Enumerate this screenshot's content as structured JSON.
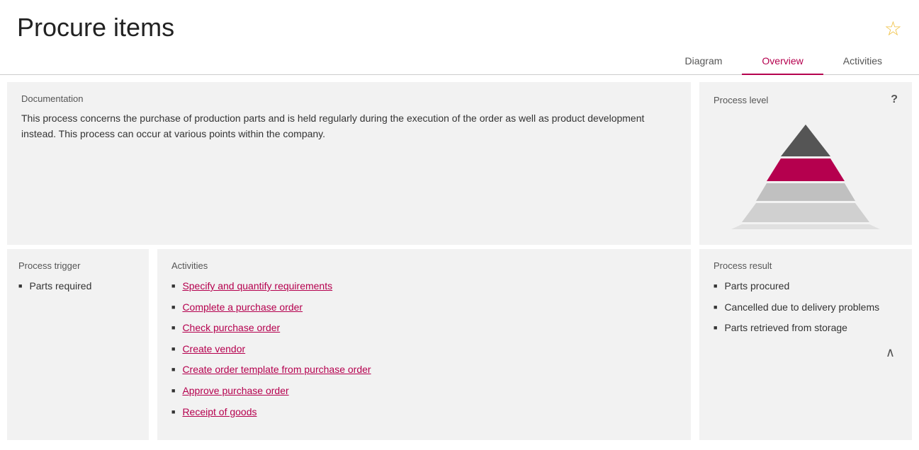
{
  "page": {
    "title": "Procure items",
    "star_icon": "★",
    "star_empty": "☆"
  },
  "tabs": [
    {
      "id": "diagram",
      "label": "Diagram",
      "active": false
    },
    {
      "id": "overview",
      "label": "Overview",
      "active": true
    },
    {
      "id": "activities",
      "label": "Activities",
      "active": false
    }
  ],
  "documentation": {
    "label": "Documentation",
    "text": "This process concerns the purchase of production parts and is held regularly during the execution of the order as well as product development instead. This process can occur at various points within the company."
  },
  "process_level": {
    "label": "Process level",
    "help_icon": "?"
  },
  "process_trigger": {
    "label": "Process trigger",
    "items": [
      "Parts required"
    ]
  },
  "activities": {
    "label": "Activities",
    "items": [
      "Specify and quantify requirements",
      "Complete a purchase order",
      "Check purchase order",
      "Create vendor",
      "Create order template from purchase order",
      "Approve purchase order",
      "Receipt of goods"
    ]
  },
  "process_result": {
    "label": "Process result",
    "items": [
      {
        "text": "Parts procured",
        "multiline": false
      },
      {
        "text": "Cancelled due to delivery problems",
        "multiline": true
      },
      {
        "text": "Parts retrieved from storage",
        "multiline": true
      }
    ]
  },
  "colors": {
    "accent": "#b5004e",
    "bg_panel": "#f2f2f2",
    "tab_border": "#ccc"
  }
}
